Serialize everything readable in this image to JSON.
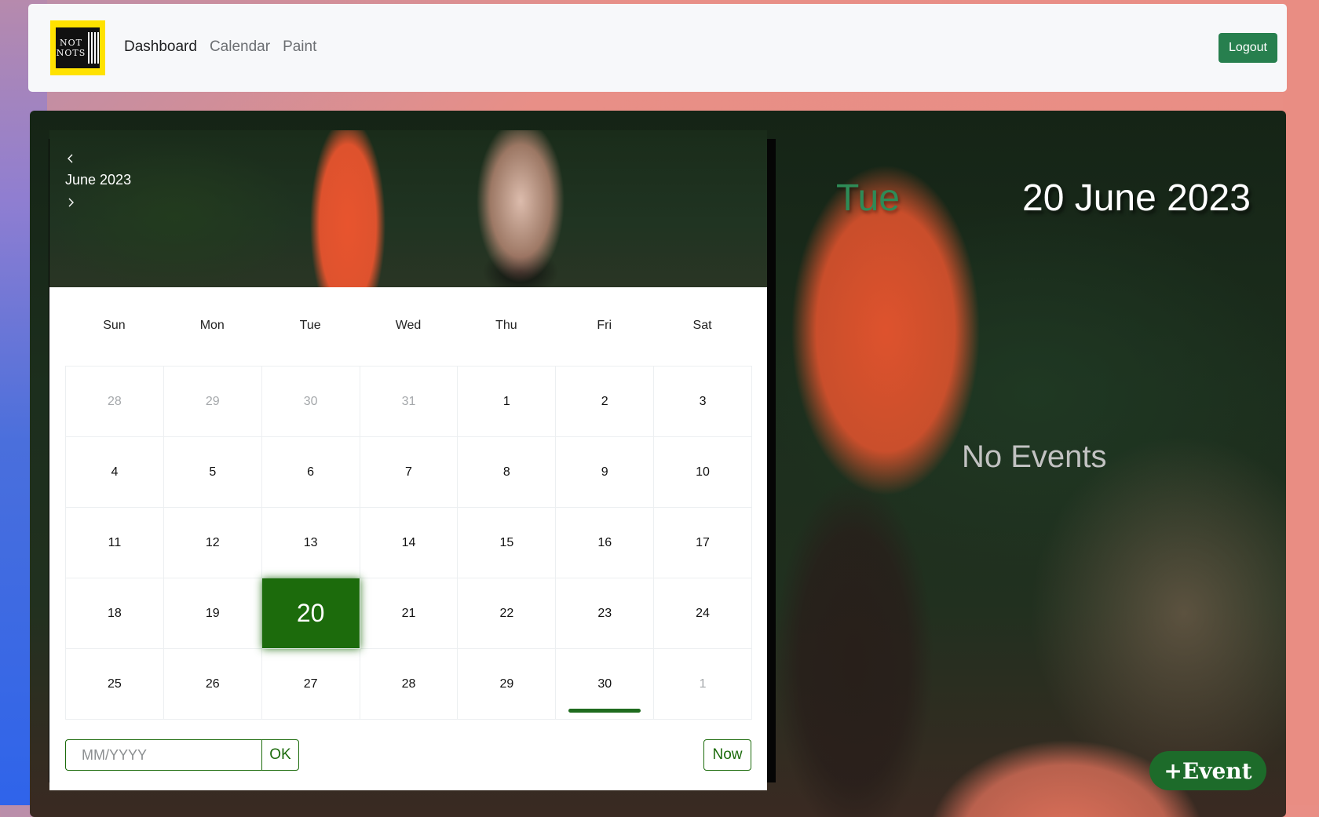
{
  "nav": {
    "logo_lines": [
      "NOT",
      "NOTS"
    ],
    "links": [
      {
        "label": "Dashboard",
        "active": true
      },
      {
        "label": "Calendar",
        "active": false
      },
      {
        "label": "Paint",
        "active": false
      }
    ],
    "logout_label": "Logout"
  },
  "calendar": {
    "month_label": "June 2023",
    "prev_icon": "chevron-left-icon",
    "next_icon": "chevron-right-icon",
    "weekdays": [
      "Sun",
      "Mon",
      "Tue",
      "Wed",
      "Thu",
      "Fri",
      "Sat"
    ],
    "days": [
      {
        "n": "28",
        "muted": true
      },
      {
        "n": "29",
        "muted": true
      },
      {
        "n": "30",
        "muted": true
      },
      {
        "n": "31",
        "muted": true
      },
      {
        "n": "1"
      },
      {
        "n": "2"
      },
      {
        "n": "3"
      },
      {
        "n": "4"
      },
      {
        "n": "5"
      },
      {
        "n": "6"
      },
      {
        "n": "7"
      },
      {
        "n": "8"
      },
      {
        "n": "9"
      },
      {
        "n": "10"
      },
      {
        "n": "11"
      },
      {
        "n": "12"
      },
      {
        "n": "13"
      },
      {
        "n": "14"
      },
      {
        "n": "15"
      },
      {
        "n": "16"
      },
      {
        "n": "17"
      },
      {
        "n": "18"
      },
      {
        "n": "19"
      },
      {
        "n": "20",
        "selected": true
      },
      {
        "n": "21"
      },
      {
        "n": "22"
      },
      {
        "n": "23"
      },
      {
        "n": "24"
      },
      {
        "n": "25"
      },
      {
        "n": "26"
      },
      {
        "n": "27"
      },
      {
        "n": "28"
      },
      {
        "n": "29"
      },
      {
        "n": "30",
        "today": true
      },
      {
        "n": "1",
        "muted": true
      }
    ],
    "date_input_placeholder": "MM/YYYY",
    "ok_label": "OK",
    "now_label": "Now"
  },
  "detail": {
    "day_name": "Tue",
    "full_date": "20 June 2023",
    "no_events": "No Events",
    "add_event_label": "+Event"
  },
  "colors": {
    "accent": "#1c6b0c",
    "logout": "#277f4e",
    "day_name": "#2e8b57",
    "logo_yellow": "#ffe200"
  }
}
